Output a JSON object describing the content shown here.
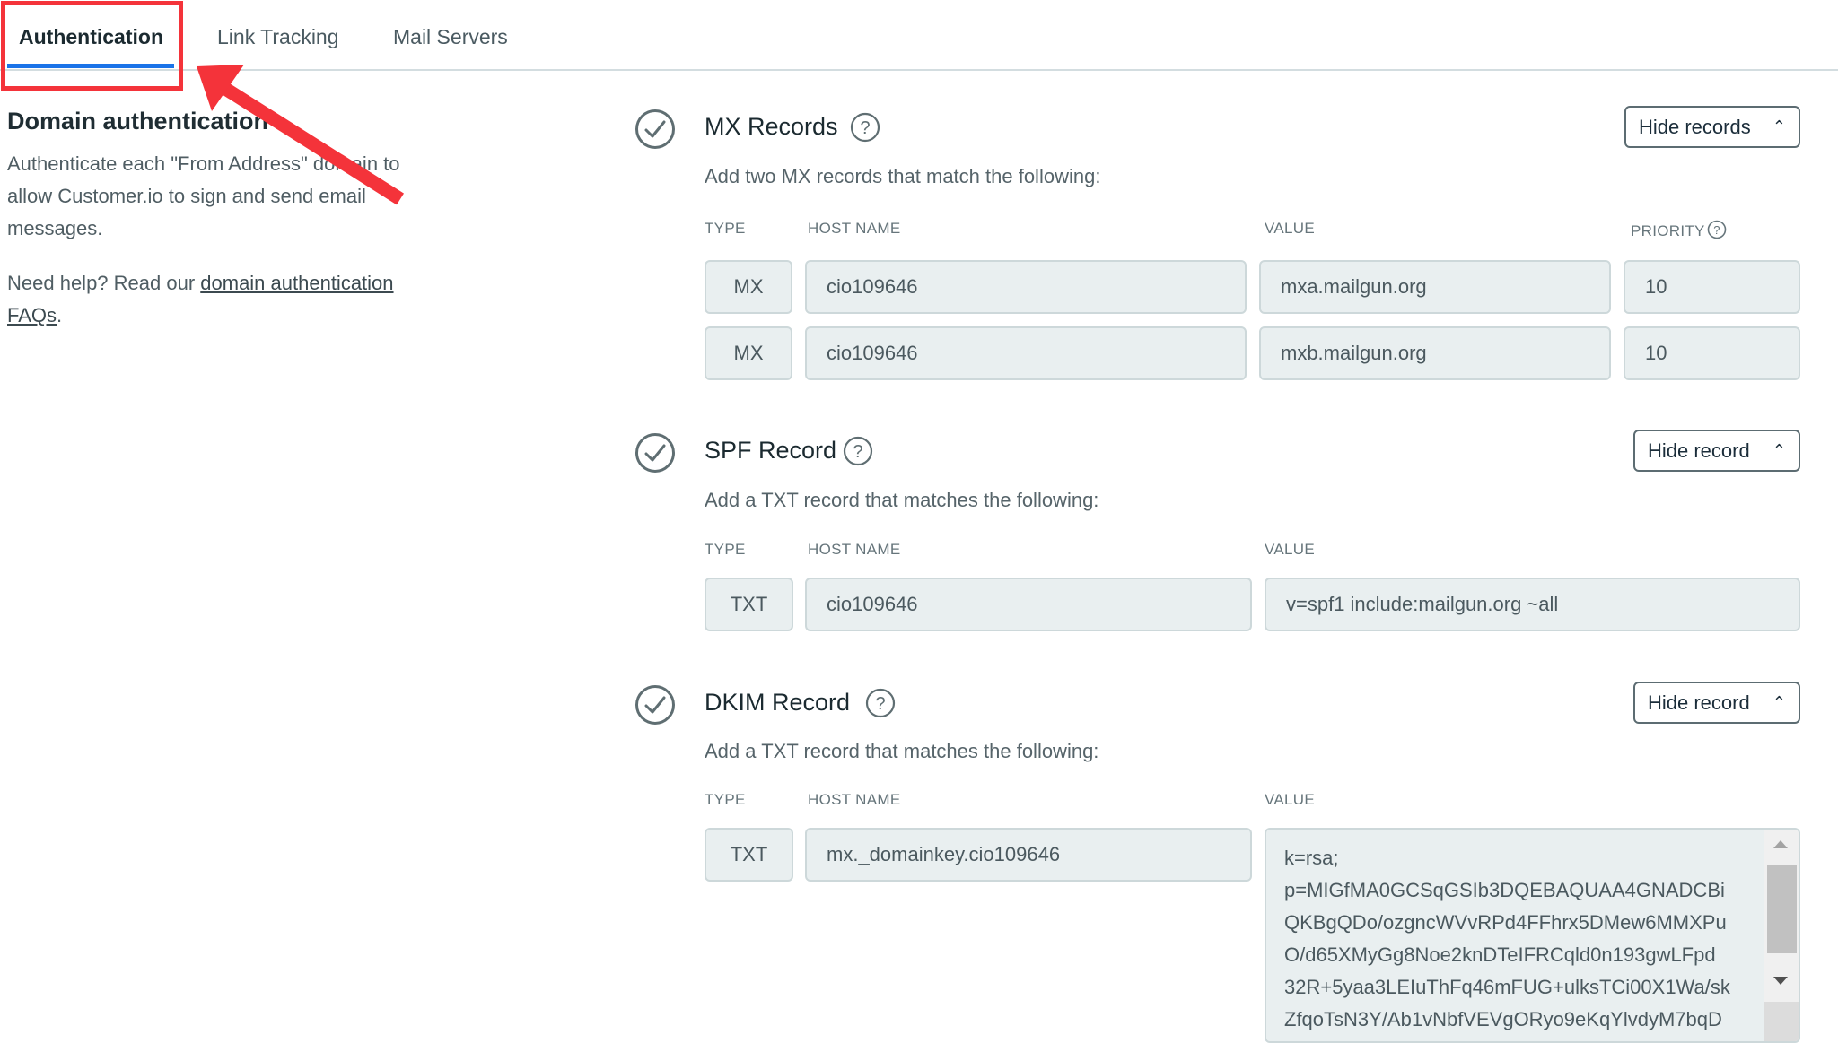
{
  "tabs": [
    {
      "label": "Authentication",
      "active": true
    },
    {
      "label": "Link Tracking",
      "active": false
    },
    {
      "label": "Mail Servers",
      "active": false
    }
  ],
  "annotation": {
    "color": "#f4333a",
    "target": "Authentication tab"
  },
  "sidebar": {
    "title": "Domain authentication",
    "description": "Authenticate each \"From Address\" domain to allow Customer.io to sign and send email messages.",
    "help_prefix": "Need help? Read our ",
    "help_link": "domain authentication FAQs",
    "help_suffix": "."
  },
  "columns": {
    "type": "TYPE",
    "host": "HOST NAME",
    "value": "VALUE",
    "priority": "PRIORITY"
  },
  "sections": {
    "mx": {
      "title": "MX Records",
      "status": "verified",
      "toggle_label": "Hide records",
      "subtitle": "Add two MX records that match the following:",
      "rows": [
        {
          "type": "MX",
          "host": "cio109646",
          "value": "mxa.mailgun.org",
          "priority": "10"
        },
        {
          "type": "MX",
          "host": "cio109646",
          "value": "mxb.mailgun.org",
          "priority": "10"
        }
      ]
    },
    "spf": {
      "title": "SPF Record",
      "status": "verified",
      "toggle_label": "Hide record",
      "subtitle": "Add a TXT record that matches the following:",
      "row": {
        "type": "TXT",
        "host": "cio109646",
        "value": "v=spf1 include:mailgun.org ~all"
      }
    },
    "dkim": {
      "title": "DKIM Record",
      "status": "verified",
      "toggle_label": "Hide record",
      "subtitle": "Add a TXT record that matches the following:",
      "row": {
        "type": "TXT",
        "host": "mx._domainkey.cio109646",
        "value_lines": [
          "k=rsa;",
          "p=MIGfMA0GCSqGSIb3DQEBAQUAA4GNADCBi",
          "QKBgQDo/ozgncWVvRPd4FFhrx5DMew6MMXPu",
          "O/d65XMyGg8Noe2knDTeIFRCqld0n193gwLFpd",
          "32R+5yaa3LEIuThFq46mFUG+ulksTCi00X1Wa/sk",
          "ZfqoTsN3Y/Ab1vNbfVEVgORyo9eKqYlvdyM7bqD"
        ]
      }
    }
  }
}
